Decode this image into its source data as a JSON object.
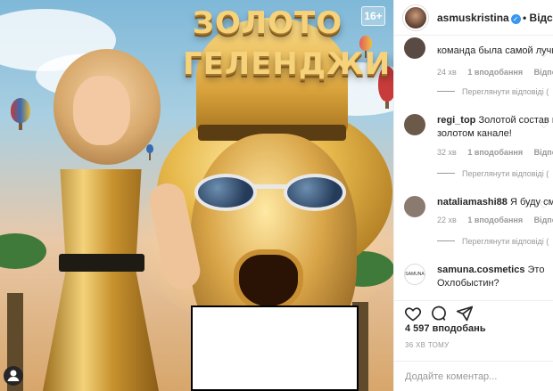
{
  "media": {
    "title_line1": "ЗОЛОТО",
    "title_line2": "ГЕЛЕНДЖИКА",
    "age_rating": "16+",
    "colors": {
      "gold": "#f6d27a",
      "sky": "#7fb8d8"
    }
  },
  "post": {
    "username": "asmuskristina",
    "verified_icon": "✓",
    "follow_label": "• Відстежу"
  },
  "comments": [
    {
      "username": "",
      "text": "команда была самой лучше",
      "time": "24 хв",
      "likes": "1 вподобання",
      "reply": "Відпові",
      "view_replies": "Переглянути відповіді (",
      "avatar_color": "#5a4a44"
    },
    {
      "username": "regi_top",
      "text": "Золотой состав на",
      "text2": "золотом канале!",
      "time": "32 хв",
      "likes": "1 вподобання",
      "reply": "Відпові",
      "view_replies": "Переглянути відповіді (",
      "avatar_color": "#6b5a4a"
    },
    {
      "username": "nataliamashi88",
      "text": "Я буду смот",
      "time": "22 хв",
      "likes": "1 вподобання",
      "reply": "Відпові",
      "view_replies": "Переглянути відповіді (",
      "avatar_color": "#8a7a70"
    },
    {
      "username": "samuna.cosmetics",
      "text": "Это",
      "text2": "Охлобыстин?",
      "avatar_label": "SAMUNA",
      "avatar_color": "#ffffff"
    }
  ],
  "actions": {
    "likes_text": "4 597 вподобань",
    "time_ago": "36 ХВ ТОМУ",
    "comment_placeholder": "Додайте коментар..."
  },
  "icons": [
    "heart-icon",
    "comment-icon",
    "share-icon",
    "user-tag-icon"
  ]
}
